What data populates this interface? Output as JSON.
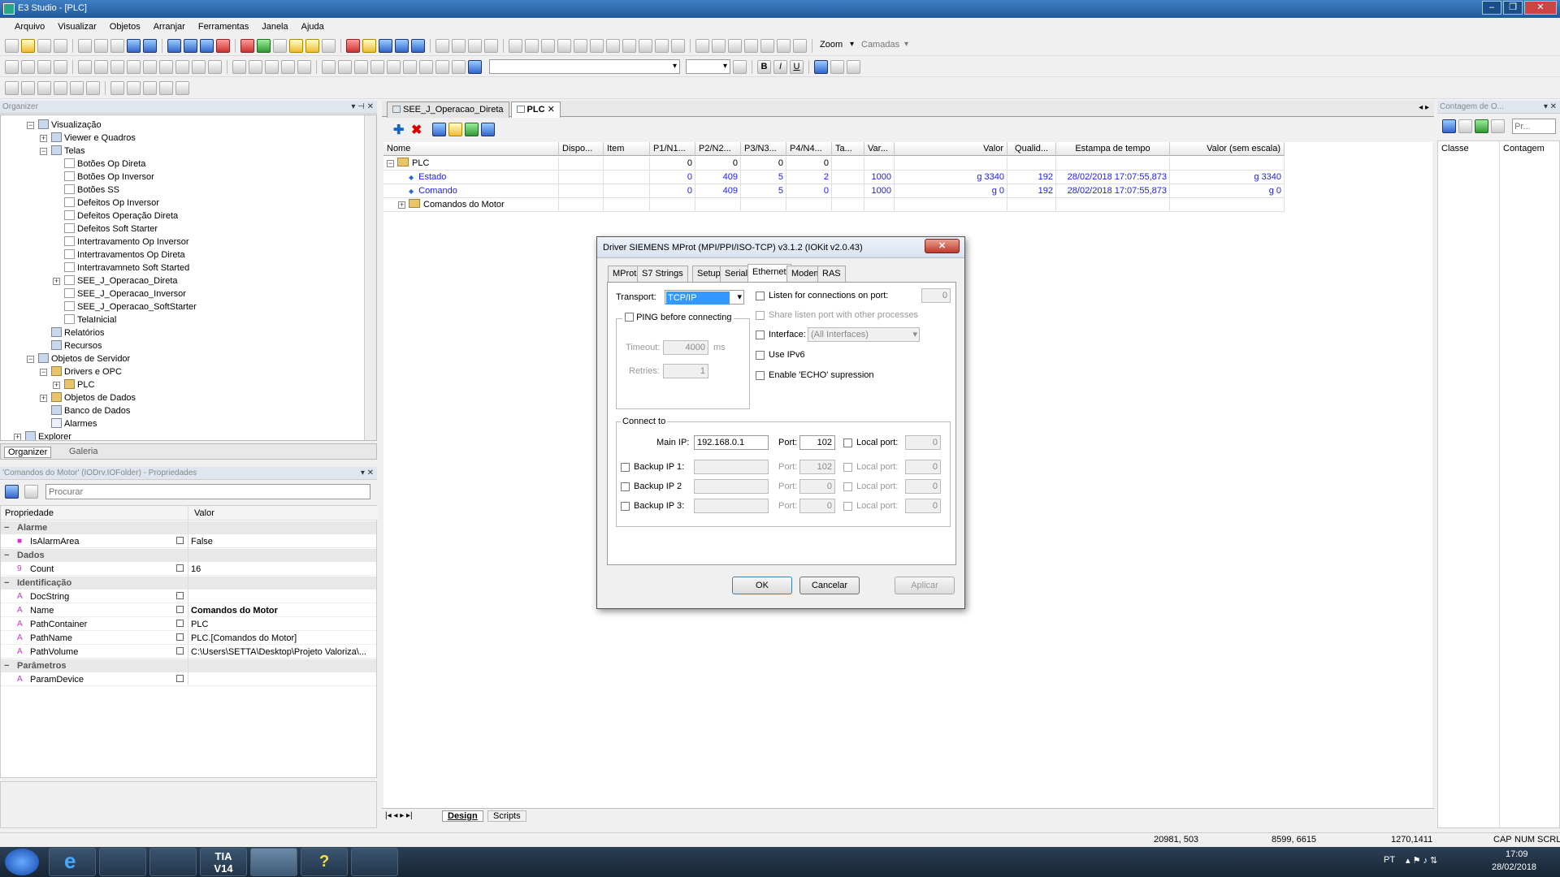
{
  "window": {
    "title": "E3 Studio - [PLC]"
  },
  "menu": [
    "Arquivo",
    "Visualizar",
    "Objetos",
    "Arranjar",
    "Ferramentas",
    "Janela",
    "Ajuda"
  ],
  "toolbar": {
    "zoom_label": "Zoom",
    "layers_label": "Camadas"
  },
  "organizer": {
    "title": "Organizer",
    "items": [
      {
        "label": "Visualização",
        "level": 1,
        "exp": "-",
        "icon": "s"
      },
      {
        "label": "Viewer e Quadros",
        "level": 2,
        "exp": "+",
        "icon": "s"
      },
      {
        "label": "Telas",
        "level": 2,
        "exp": "-",
        "icon": "s"
      },
      {
        "label": "Botões Op Direta",
        "level": 3,
        "exp": "",
        "icon": "d"
      },
      {
        "label": "Botões Op Inversor",
        "level": 3,
        "exp": "",
        "icon": "d"
      },
      {
        "label": "Botões SS",
        "level": 3,
        "exp": "",
        "icon": "d"
      },
      {
        "label": "Defeitos Op Inversor",
        "level": 3,
        "exp": "",
        "icon": "d"
      },
      {
        "label": "Defeitos Operação Direta",
        "level": 3,
        "exp": "",
        "icon": "d"
      },
      {
        "label": "Defeitos Soft Starter",
        "level": 3,
        "exp": "",
        "icon": "d"
      },
      {
        "label": "Intertravamento Op Inversor",
        "level": 3,
        "exp": "",
        "icon": "d"
      },
      {
        "label": "Intertravamentos Op Direta",
        "level": 3,
        "exp": "",
        "icon": "d"
      },
      {
        "label": "Intertravamneto Soft Started",
        "level": 3,
        "exp": "",
        "icon": "d"
      },
      {
        "label": "SEE_J_Operacao_Direta",
        "level": 3,
        "exp": "+",
        "icon": "d"
      },
      {
        "label": "SEE_J_Operacao_Inversor",
        "level": 3,
        "exp": "",
        "icon": "d"
      },
      {
        "label": "SEE_J_Operacao_SoftStarter",
        "level": 3,
        "exp": "",
        "icon": "d"
      },
      {
        "label": "TelaInicial",
        "level": 3,
        "exp": "",
        "icon": "d"
      },
      {
        "label": "Relatórios",
        "level": 2,
        "exp": "",
        "icon": "s"
      },
      {
        "label": "Recursos",
        "level": 2,
        "exp": "",
        "icon": "s"
      },
      {
        "label": "Objetos de Servidor",
        "level": 1,
        "exp": "-",
        "icon": "s"
      },
      {
        "label": "Drivers e OPC",
        "level": 2,
        "exp": "-",
        "icon": "f"
      },
      {
        "label": "PLC",
        "level": 3,
        "exp": "+",
        "icon": "f"
      },
      {
        "label": "Objetos de Dados",
        "level": 2,
        "exp": "+",
        "icon": "f"
      },
      {
        "label": "Banco de Dados",
        "level": 2,
        "exp": "",
        "icon": "s"
      },
      {
        "label": "Alarmes",
        "level": 2,
        "exp": "",
        "icon": "y"
      },
      {
        "label": "Explorer",
        "level": 0,
        "exp": "+",
        "icon": "s"
      }
    ],
    "tab_organizer": "Organizer",
    "tab_gallery": "Galeria"
  },
  "properties": {
    "title": "'Comandos do Motor' (IODrv.IOFolder) - Propriedades",
    "search_placeholder": "Procurar",
    "col_property": "Propriedade",
    "col_value": "Valor",
    "rows": [
      {
        "cat": true,
        "name": "Alarme"
      },
      {
        "name": "IsAlarmArea",
        "value": "False",
        "icon": "■"
      },
      {
        "cat": true,
        "name": "Dados"
      },
      {
        "name": "Count",
        "value": "16",
        "icon": "9"
      },
      {
        "cat": true,
        "name": "Identificação"
      },
      {
        "name": "DocString",
        "value": "",
        "icon": "A"
      },
      {
        "name": "Name",
        "value": "Comandos do Motor",
        "icon": "A",
        "bold": true
      },
      {
        "name": "PathContainer",
        "value": "PLC",
        "icon": "A"
      },
      {
        "name": "PathName",
        "value": "PLC.[Comandos do Motor]",
        "icon": "A"
      },
      {
        "name": "PathVolume",
        "value": "C:\\Users\\SETTA\\Desktop\\Projeto Valoriza\\...",
        "icon": "A"
      },
      {
        "cat": true,
        "name": "Parâmetros"
      },
      {
        "name": "ParamDevice",
        "value": "",
        "icon": "A"
      }
    ]
  },
  "doc_tabs": [
    {
      "label": "SEE_J_Operacao_Direta",
      "active": false
    },
    {
      "label": "PLC",
      "active": true
    }
  ],
  "grid": {
    "columns": [
      "Nome",
      "Dispo...",
      "Item",
      "P1/N1...",
      "P2/N2...",
      "P3/N3...",
      "P4/N4...",
      "Ta...",
      "Var...",
      "Valor",
      "Qualid...",
      "Estampa de tempo",
      "Valor (sem escala)"
    ],
    "rows": [
      {
        "cells": [
          "PLC",
          "",
          "",
          "0",
          "0",
          "0",
          "0",
          "",
          "",
          "",
          "",
          "",
          ""
        ],
        "blue": false,
        "icon": "f",
        "exp": "-",
        "indent": 0
      },
      {
        "cells": [
          "Estado",
          "",
          "",
          "0",
          "409",
          "5",
          "2",
          "",
          "1000",
          "g 3340",
          "192",
          "28/02/2018 17:07:55,873",
          "g 3340"
        ],
        "blue": true,
        "icon": "dot",
        "exp": "",
        "indent": 1
      },
      {
        "cells": [
          "Comando",
          "",
          "",
          "0",
          "409",
          "5",
          "0",
          "",
          "1000",
          "g 0",
          "192",
          "28/02/2018 17:07:55,873",
          "g 0"
        ],
        "blue": true,
        "icon": "dot",
        "exp": "",
        "indent": 1
      },
      {
        "cells": [
          "Comandos do Motor",
          "",
          "",
          "",
          "",
          "",
          "",
          "",
          "",
          "",
          "",
          "",
          ""
        ],
        "blue": false,
        "icon": "f",
        "exp": "+",
        "indent": 1
      }
    ]
  },
  "bottom_tabs": {
    "design": "Design",
    "scripts": "Scripts"
  },
  "dialog": {
    "title": "Driver SIEMENS MProt (MPI/PPI/ISO-TCP) v3.1.2 (IOKit v2.0.43)",
    "tabs": [
      "MProt",
      "S7 Strings",
      "Setup",
      "Serial",
      "Ethernet",
      "Modem",
      "RAS"
    ],
    "active_tab": "Ethernet",
    "transport_label": "Transport:",
    "transport_value": "TCP/IP",
    "ping_label": "PING before connecting",
    "timeout_label": "Timeout:",
    "timeout_value": "4000",
    "timeout_unit": "ms",
    "retries_label": "Retries:",
    "retries_value": "1",
    "listen_label": "Listen for connections on port:",
    "listen_port": "0",
    "share_label": "Share listen port with other processes",
    "interface_label": "Interface:",
    "interface_value": "(All Interfaces)",
    "ipv6_label": "Use IPv6",
    "echo_label": "Enable 'ECHO' supression",
    "connect_group": "Connect to",
    "main_ip_label": "Main IP:",
    "main_ip": "192.168.0.1",
    "port_label": "Port:",
    "main_port": "102",
    "local_port_label": "Local port:",
    "main_local": "0",
    "backups": [
      {
        "label": "Backup IP 1:",
        "port": "102",
        "local": "0"
      },
      {
        "label": "Backup IP 2",
        "port": "0",
        "local": "0"
      },
      {
        "label": "Backup IP 3:",
        "port": "0",
        "local": "0"
      }
    ],
    "ok": "OK",
    "cancel": "Cancelar",
    "apply": "Aplicar"
  },
  "right_panel": {
    "title": "Contagem de O...",
    "search_placeholder": "Pr...",
    "col_class": "Classe",
    "col_count": "Contagem"
  },
  "status": {
    "coords1": "20981, 503",
    "coords2": "8599, 6615",
    "coords3": "1270,1411",
    "caps": "CAP",
    "num": "NUM",
    "scrl": "SCRL"
  },
  "taskbar": {
    "lang": "PT",
    "time": "17:09",
    "date": "28/02/2018",
    "tia": "TIA\nV14"
  }
}
